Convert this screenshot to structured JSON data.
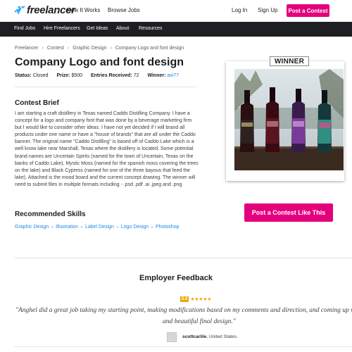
{
  "header": {
    "logo_text": "freelancer",
    "nav": [
      "How It Works",
      "Browse Jobs"
    ],
    "login": "Log In",
    "signup": "Sign Up",
    "post_contest": "Post a Contest"
  },
  "navbar": {
    "items": [
      "Find Jobs",
      "Hire Freelancers",
      "Get Ideas",
      "About",
      "Resources"
    ]
  },
  "breadcrumb": [
    "Freelancer",
    "Contest",
    "Graphic Design",
    "Company Logo and font design"
  ],
  "contest": {
    "title": "Company Logo and font design",
    "status_label": "Status:",
    "status": "Closed",
    "prize_label": "Prize:",
    "prize": "$500",
    "entries_label": "Entries Received:",
    "entries": "72",
    "winner_label": "Winner:",
    "winner": "avi77"
  },
  "brief": {
    "heading": "Contest Brief",
    "text": "I am starting a craft distillery in Texas named Caddo Distilling Company. I have a concept for a logo and company font that was done by a beverage marketing firm but I would like to consider other ideas. I have not yet decided if I will brand all products under one name or have a \"house of brands\" that are all under the Caddo banner. The original name \"Caddo Distilling\" is based off of Caddo Lake which is a well know lake near Marshall, Texas where the distillery is located. Some potential brand names are Uncertain Spirits (named for the town of Uncertain, Texas on the banks of Caddo Lake), Mystic Moss (named for the spanish moss covering the trees on the lake) and Black Cypress (named for one of the three bayous that feed the lake). Attached is the mood board and the current concept drawing. The winner will need to submit files in multiple formats including - .psd .pdf .ai .jpeg and .png"
  },
  "skills": {
    "heading": "Recommended Skills",
    "items": [
      "Graphic Design",
      "Illustration",
      "Label Design",
      "Logo Design",
      "Photoshop"
    ]
  },
  "winner_card": {
    "badge": "WINNER"
  },
  "cta": {
    "post_like": "Post a Contest Like This"
  },
  "feedback": {
    "title": "Employer Feedback",
    "rating": "5.0",
    "stars": "★★★★★",
    "quote_line1": "\"Anghel did a great job taking my starting point, making modifications based on my comments and direction, and coming up with",
    "quote_line2": "and beautiful final design.\"",
    "reviewer": "scottcarlile",
    "location": ", United States."
  },
  "colors": {
    "brand_pink": "#e4007c",
    "navbar_dark": "#1e1f22",
    "link_blue": "#1e88e5",
    "logo_blue": "#29b2fe",
    "star_gold": "#f0a500"
  }
}
